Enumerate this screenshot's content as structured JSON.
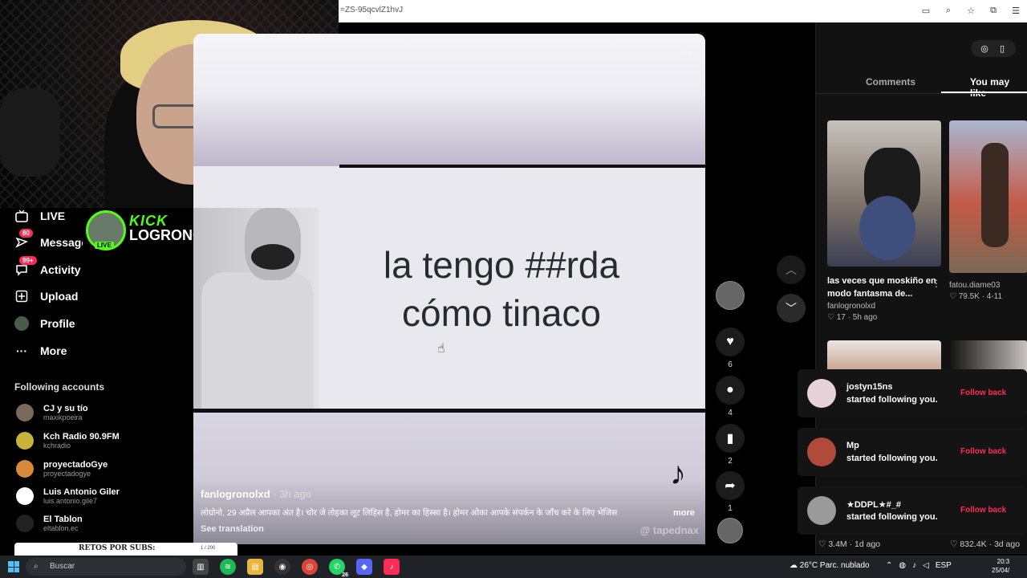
{
  "browser": {
    "url": "=ZS-95qcvlZ1hvJ"
  },
  "stream": {
    "kick_label": "KICK",
    "streamer_name": "LOGRONOL",
    "live_badge": "LIVE"
  },
  "sidebar": {
    "items": [
      {
        "label": "LIVE",
        "icon": "live-tv-icon"
      },
      {
        "label": "Message",
        "icon": "message-icon",
        "badge": "80"
      },
      {
        "label": "Activity",
        "icon": "activity-icon",
        "badge": "99+"
      },
      {
        "label": "Upload",
        "icon": "upload-icon"
      },
      {
        "label": "Profile",
        "icon": "profile-avatar"
      },
      {
        "label": "More",
        "icon": "more-icon"
      }
    ],
    "following_title": "Following accounts",
    "following": [
      {
        "name": "CJ y su tío",
        "handle": "maxikpoeira",
        "color": "#7a6a5a"
      },
      {
        "name": "Kch Radio 90.9FM",
        "handle": "kchradio",
        "color": "#c9b23a"
      },
      {
        "name": "proyectadoGye",
        "handle": "proyectadogye",
        "color": "#d88a3a"
      },
      {
        "name": "Luis Antonio Giler",
        "handle": "luis.antonio.gile7",
        "color": "#ffffff"
      },
      {
        "name": "El Tablon",
        "handle": "eltablon.ec",
        "color": "#222222"
      }
    ]
  },
  "video": {
    "caption_line1": "la tengo ##rda",
    "caption_line2": "cómo tinaco",
    "author": "fanlogronolxd",
    "time": " · 3h ago",
    "description": "लोग्रोनो, 29 अप्रैल आपका अंत है। चोर जे तोहका लूट लिहिस है, होमर का हिस्सा है। होमर ओका आपके संपर्कन के जाँच करे के लिए भेजिस",
    "more_label": "more",
    "see_translation": "See translation",
    "watermark": "@ tapednax"
  },
  "actions": {
    "likes": "6",
    "comments": "4",
    "saves": "2",
    "shares": "1"
  },
  "panel": {
    "tab_comments": "Comments",
    "tab_you_may_like": "You may like",
    "cards": [
      {
        "title": "las veces que moskiño en modo fantasma de...",
        "author": "fanlogronolxd",
        "stats": "♡ 17 · 5h ago"
      },
      {
        "title": "",
        "author": "fatou.diame03",
        "stats": "♡ 79.5K · 4-11"
      }
    ]
  },
  "notifications": [
    {
      "name": "jostyn15ns",
      "message": "started following you.",
      "action": "Follow back"
    },
    {
      "name": "Mp",
      "message": "started following you.",
      "action": "Follow back"
    },
    {
      "name": "★DDPL★#_#",
      "message": "started following you.",
      "action": "Follow back"
    }
  ],
  "bottom_stats": {
    "left": "♡ 3.4M · 1d ago",
    "right": "♡ 832.4K · 3d ago"
  },
  "subs_goal": {
    "title": "RETOS POR SUBS:",
    "count": "1 / 200",
    "percent_label": "1%",
    "fraction": 0.01
  },
  "taskbar": {
    "search_placeholder": "Buscar",
    "weather": "26°C  Parc. nublado",
    "language": "ESP",
    "whatsapp_badge": "26",
    "time": "20:3",
    "date": "25/04/"
  }
}
